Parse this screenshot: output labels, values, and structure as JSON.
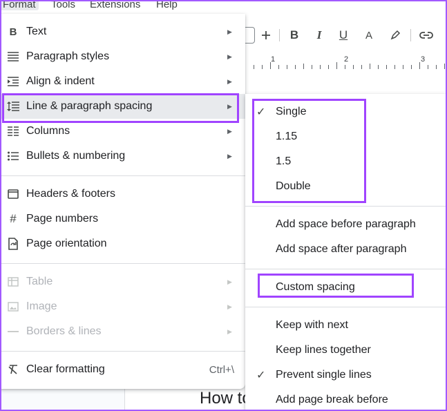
{
  "menubar": {
    "format": "Format",
    "tools": "Tools",
    "extensions": "Extensions",
    "help": "Help"
  },
  "toolbar": {
    "icons": [
      "plus-icon",
      "bold-icon",
      "italic-icon",
      "underline-icon",
      "text-color-icon",
      "highlight-icon",
      "link-icon"
    ],
    "bold": "B",
    "italic": "I",
    "underline": "U",
    "text_color": "A"
  },
  "ruler": {
    "marks": [
      "1",
      "2",
      "3"
    ]
  },
  "document": {
    "heading": "How to"
  },
  "format_menu": {
    "items": [
      {
        "label": "Text",
        "icon": "bold-icon",
        "arrow": "▶"
      },
      {
        "label": "Paragraph styles",
        "icon": "paragraph-styles-icon",
        "arrow": "▶"
      },
      {
        "label": "Align & indent",
        "icon": "indent-icon",
        "arrow": "▶"
      },
      {
        "label": "Line & paragraph spacing",
        "icon": "line-spacing-icon",
        "arrow": "▶"
      },
      {
        "label": "Columns",
        "icon": "columns-icon",
        "arrow": "▶"
      },
      {
        "label": "Bullets & numbering",
        "icon": "bulleted-list-icon",
        "arrow": "▶"
      },
      {
        "label": "Headers & footers",
        "icon": "header-footer-icon"
      },
      {
        "label": "Page numbers",
        "icon": "hash-icon"
      },
      {
        "label": "Page orientation",
        "icon": "page-orientation-icon"
      },
      {
        "label": "Table",
        "icon": "table-icon",
        "arrow": "▶",
        "disabled": true
      },
      {
        "label": "Image",
        "icon": "image-icon",
        "arrow": "▶",
        "disabled": true
      },
      {
        "label": "Borders & lines",
        "icon": "borders-icon",
        "arrow": "▶",
        "disabled": true
      },
      {
        "label": "Clear formatting",
        "icon": "clear-formatting-icon",
        "shortcut": "Ctrl+\\"
      }
    ]
  },
  "spacing_submenu": {
    "items": [
      {
        "label": "Single",
        "checked": true
      },
      {
        "label": "1.15"
      },
      {
        "label": "1.5"
      },
      {
        "label": "Double"
      },
      {
        "label": "Add space before paragraph"
      },
      {
        "label": "Add space after paragraph"
      },
      {
        "label": "Custom spacing"
      },
      {
        "label": "Keep with next"
      },
      {
        "label": "Keep lines together"
      },
      {
        "label": "Prevent single lines",
        "checked": true
      },
      {
        "label": "Add page break before"
      }
    ],
    "check_glyph": "✓"
  },
  "colors": {
    "highlight": "#a044ff",
    "menu_active": "#e8eaed",
    "disabled_text": "#b0b3b8"
  }
}
